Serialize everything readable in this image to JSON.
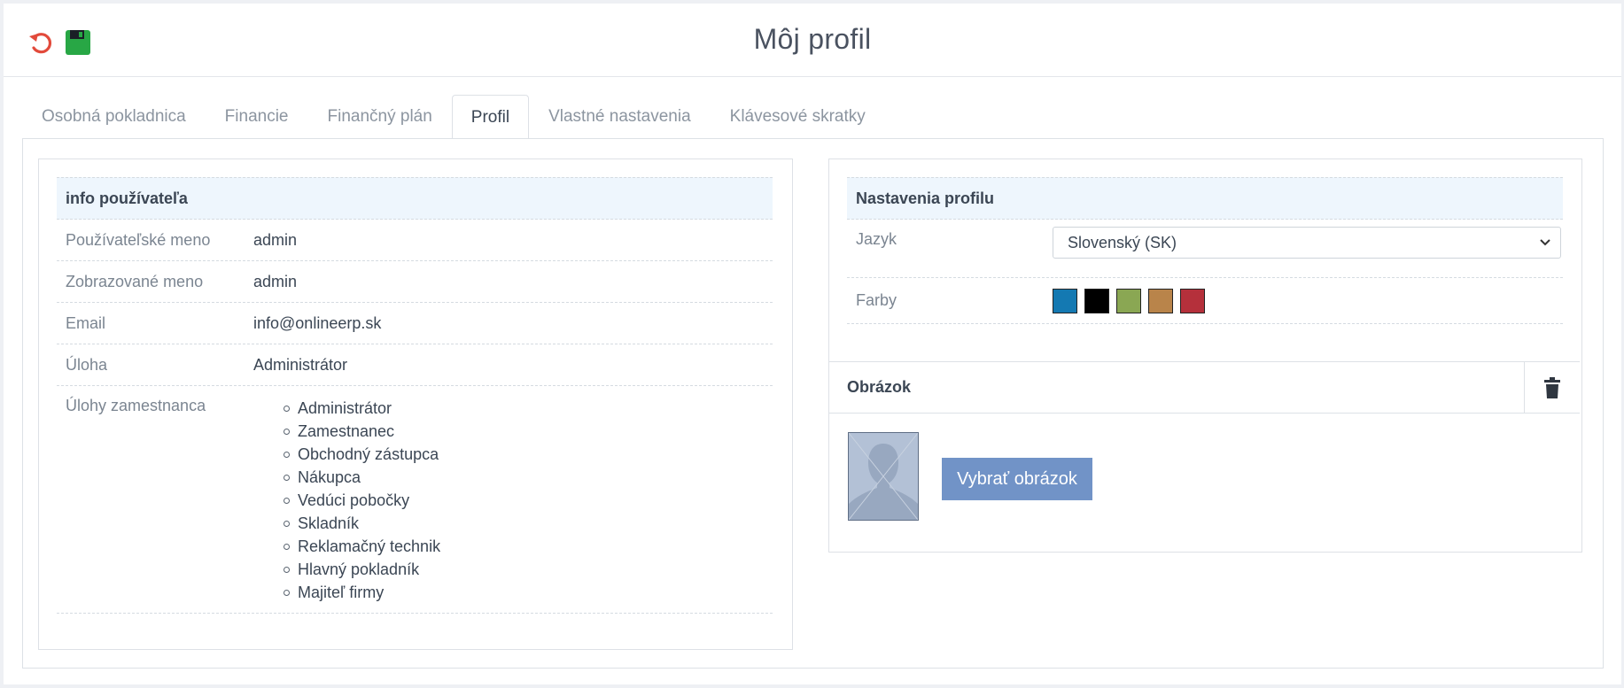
{
  "header": {
    "title": "Môj profil",
    "reset_icon": "undo-icon",
    "save_icon": "floppy-disk-icon",
    "reset_color": "#e24a3b",
    "save_color": "#28a745"
  },
  "tabs": [
    {
      "label": "Osobná pokladnica",
      "active": false
    },
    {
      "label": "Financie",
      "active": false
    },
    {
      "label": "Finančný plán",
      "active": false
    },
    {
      "label": "Profil",
      "active": true
    },
    {
      "label": "Vlastné nastavenia",
      "active": false
    },
    {
      "label": "Klávesové skratky",
      "active": false
    }
  ],
  "user_info": {
    "heading": "info používateľa",
    "username": {
      "label": "Používateľské meno",
      "value": "admin"
    },
    "display_name": {
      "label": "Zobrazované meno",
      "value": "admin"
    },
    "email": {
      "label": "Email",
      "value": "info@onlineerp.sk"
    },
    "role": {
      "label": "Úloha",
      "value": "Administrátor"
    },
    "employee_roles": {
      "label": "Úlohy zamestnanca",
      "items": [
        "Administrátor",
        "Zamestnanec",
        "Obchodný zástupca",
        "Nákupca",
        "Vedúci pobočky",
        "Skladník",
        "Reklamačný technik",
        "Hlavný pokladník",
        "Majiteľ firmy"
      ]
    }
  },
  "profile_settings": {
    "heading": "Nastavenia profilu",
    "language": {
      "label": "Jazyk",
      "value": "Slovenský (SK)"
    },
    "colors": {
      "label": "Farby",
      "swatches": [
        "#1479b2",
        "#000000",
        "#8aa753",
        "#b9844a",
        "#b5303b"
      ]
    }
  },
  "picture": {
    "heading": "Obrázok",
    "delete_icon": "trash-icon",
    "choose_button": "Vybrať obrázok",
    "button_color": "#7193c7"
  }
}
